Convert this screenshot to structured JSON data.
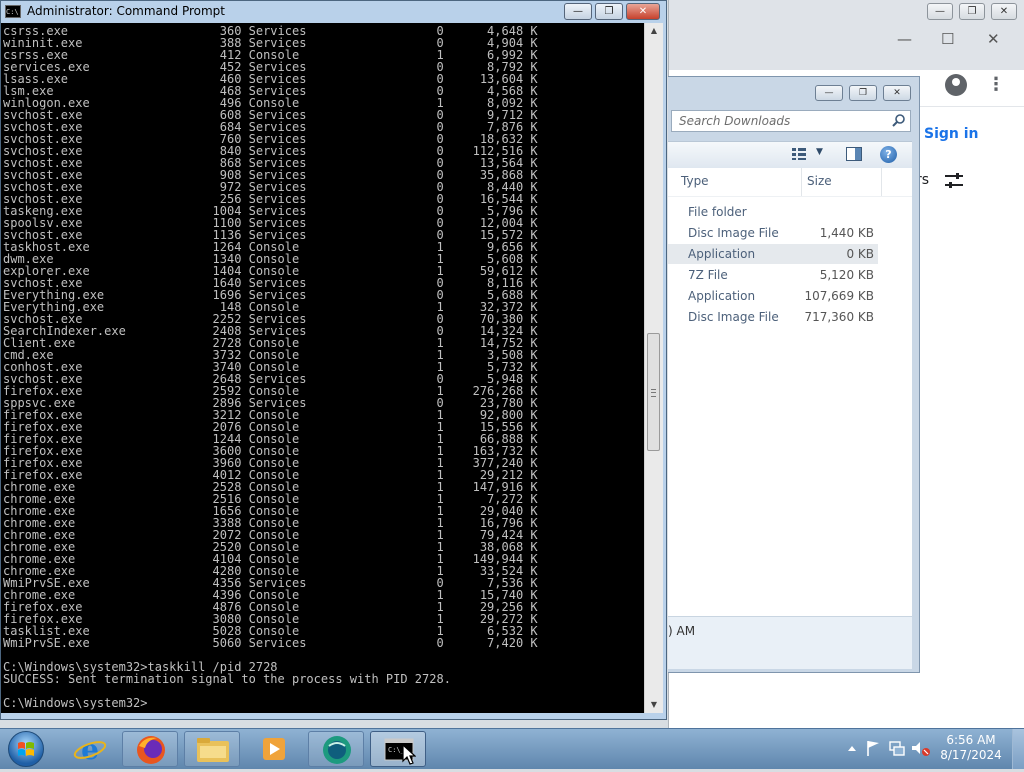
{
  "cmd": {
    "title": "Administrator: Command Prompt",
    "icon_label": "C:\\",
    "buttons": {
      "minimize": "—",
      "maximize": "❐",
      "close": "✕"
    },
    "processes": [
      [
        "csrss.exe",
        "360",
        "Services",
        "0",
        "4,648 K"
      ],
      [
        "wininit.exe",
        "388",
        "Services",
        "0",
        "4,904 K"
      ],
      [
        "csrss.exe",
        "412",
        "Console",
        "1",
        "6,992 K"
      ],
      [
        "services.exe",
        "452",
        "Services",
        "0",
        "8,792 K"
      ],
      [
        "lsass.exe",
        "460",
        "Services",
        "0",
        "13,604 K"
      ],
      [
        "lsm.exe",
        "468",
        "Services",
        "0",
        "4,568 K"
      ],
      [
        "winlogon.exe",
        "496",
        "Console",
        "1",
        "8,092 K"
      ],
      [
        "svchost.exe",
        "608",
        "Services",
        "0",
        "9,712 K"
      ],
      [
        "svchost.exe",
        "684",
        "Services",
        "0",
        "7,876 K"
      ],
      [
        "svchost.exe",
        "760",
        "Services",
        "0",
        "18,632 K"
      ],
      [
        "svchost.exe",
        "840",
        "Services",
        "0",
        "112,516 K"
      ],
      [
        "svchost.exe",
        "868",
        "Services",
        "0",
        "13,564 K"
      ],
      [
        "svchost.exe",
        "908",
        "Services",
        "0",
        "35,868 K"
      ],
      [
        "svchost.exe",
        "972",
        "Services",
        "0",
        "8,440 K"
      ],
      [
        "svchost.exe",
        "256",
        "Services",
        "0",
        "16,544 K"
      ],
      [
        "taskeng.exe",
        "1004",
        "Services",
        "0",
        "5,796 K"
      ],
      [
        "spoolsv.exe",
        "1100",
        "Services",
        "0",
        "12,004 K"
      ],
      [
        "svchost.exe",
        "1136",
        "Services",
        "0",
        "15,572 K"
      ],
      [
        "taskhost.exe",
        "1264",
        "Console",
        "1",
        "9,656 K"
      ],
      [
        "dwm.exe",
        "1340",
        "Console",
        "1",
        "5,608 K"
      ],
      [
        "explorer.exe",
        "1404",
        "Console",
        "1",
        "59,612 K"
      ],
      [
        "svchost.exe",
        "1640",
        "Services",
        "0",
        "8,116 K"
      ],
      [
        "Everything.exe",
        "1696",
        "Services",
        "0",
        "5,688 K"
      ],
      [
        "Everything.exe",
        "148",
        "Console",
        "1",
        "32,372 K"
      ],
      [
        "svchost.exe",
        "2252",
        "Services",
        "0",
        "70,380 K"
      ],
      [
        "SearchIndexer.exe",
        "2408",
        "Services",
        "0",
        "14,324 K"
      ],
      [
        "Client.exe",
        "2728",
        "Console",
        "1",
        "14,752 K"
      ],
      [
        "cmd.exe",
        "3732",
        "Console",
        "1",
        "3,508 K"
      ],
      [
        "conhost.exe",
        "3740",
        "Console",
        "1",
        "5,732 K"
      ],
      [
        "svchost.exe",
        "2648",
        "Services",
        "0",
        "5,948 K"
      ],
      [
        "firefox.exe",
        "2592",
        "Console",
        "1",
        "276,268 K"
      ],
      [
        "sppsvc.exe",
        "2896",
        "Services",
        "0",
        "23,780 K"
      ],
      [
        "firefox.exe",
        "3212",
        "Console",
        "1",
        "92,800 K"
      ],
      [
        "firefox.exe",
        "2076",
        "Console",
        "1",
        "15,556 K"
      ],
      [
        "firefox.exe",
        "1244",
        "Console",
        "1",
        "66,888 K"
      ],
      [
        "firefox.exe",
        "3600",
        "Console",
        "1",
        "163,732 K"
      ],
      [
        "firefox.exe",
        "3960",
        "Console",
        "1",
        "377,240 K"
      ],
      [
        "firefox.exe",
        "4012",
        "Console",
        "1",
        "29,212 K"
      ],
      [
        "chrome.exe",
        "2528",
        "Console",
        "1",
        "147,916 K"
      ],
      [
        "chrome.exe",
        "2516",
        "Console",
        "1",
        "7,272 K"
      ],
      [
        "chrome.exe",
        "1656",
        "Console",
        "1",
        "29,040 K"
      ],
      [
        "chrome.exe",
        "3388",
        "Console",
        "1",
        "16,796 K"
      ],
      [
        "chrome.exe",
        "2072",
        "Console",
        "1",
        "79,424 K"
      ],
      [
        "chrome.exe",
        "2520",
        "Console",
        "1",
        "38,068 K"
      ],
      [
        "chrome.exe",
        "4104",
        "Console",
        "1",
        "149,944 K"
      ],
      [
        "chrome.exe",
        "4280",
        "Console",
        "1",
        "33,524 K"
      ],
      [
        "WmiPrvSE.exe",
        "4356",
        "Services",
        "0",
        "7,536 K"
      ],
      [
        "chrome.exe",
        "4396",
        "Console",
        "1",
        "15,740 K"
      ],
      [
        "firefox.exe",
        "4876",
        "Console",
        "1",
        "29,256 K"
      ],
      [
        "firefox.exe",
        "3080",
        "Console",
        "1",
        "29,272 K"
      ],
      [
        "tasklist.exe",
        "5028",
        "Console",
        "1",
        "6,532 K"
      ],
      [
        "WmiPrvSE.exe",
        "5060",
        "Services",
        "0",
        "7,420 K"
      ]
    ],
    "command_line": "C:\\Windows\\system32>taskkill /pid 2728",
    "result_line": "SUCCESS: Sent termination signal to the process with PID 2728.",
    "prompt_line": "C:\\Windows\\system32>"
  },
  "explorer": {
    "search_placeholder": "Search Downloads",
    "columns": {
      "type": "Type",
      "size": "Size"
    },
    "rows": [
      {
        "type": "File folder",
        "size": ""
      },
      {
        "type": "Disc Image File",
        "size": "1,440 KB"
      },
      {
        "type": "Application",
        "size": "0 KB"
      },
      {
        "type": "7Z File",
        "size": "5,120 KB"
      },
      {
        "type": "Application",
        "size": "107,669 KB"
      },
      {
        "type": "Disc Image File",
        "size": "717,360 KB"
      }
    ],
    "details_fragment": ") AM"
  },
  "chrome": {
    "sign_in": "Sign in",
    "filter_fragment": "rs"
  },
  "taskbar": {
    "time": "6:56 AM",
    "date": "8/17/2024"
  },
  "colors": {
    "console_bg": "#000000",
    "console_fg": "#c0c0c0",
    "taskbar": "#6f95bd",
    "link": "#1a73e8"
  }
}
